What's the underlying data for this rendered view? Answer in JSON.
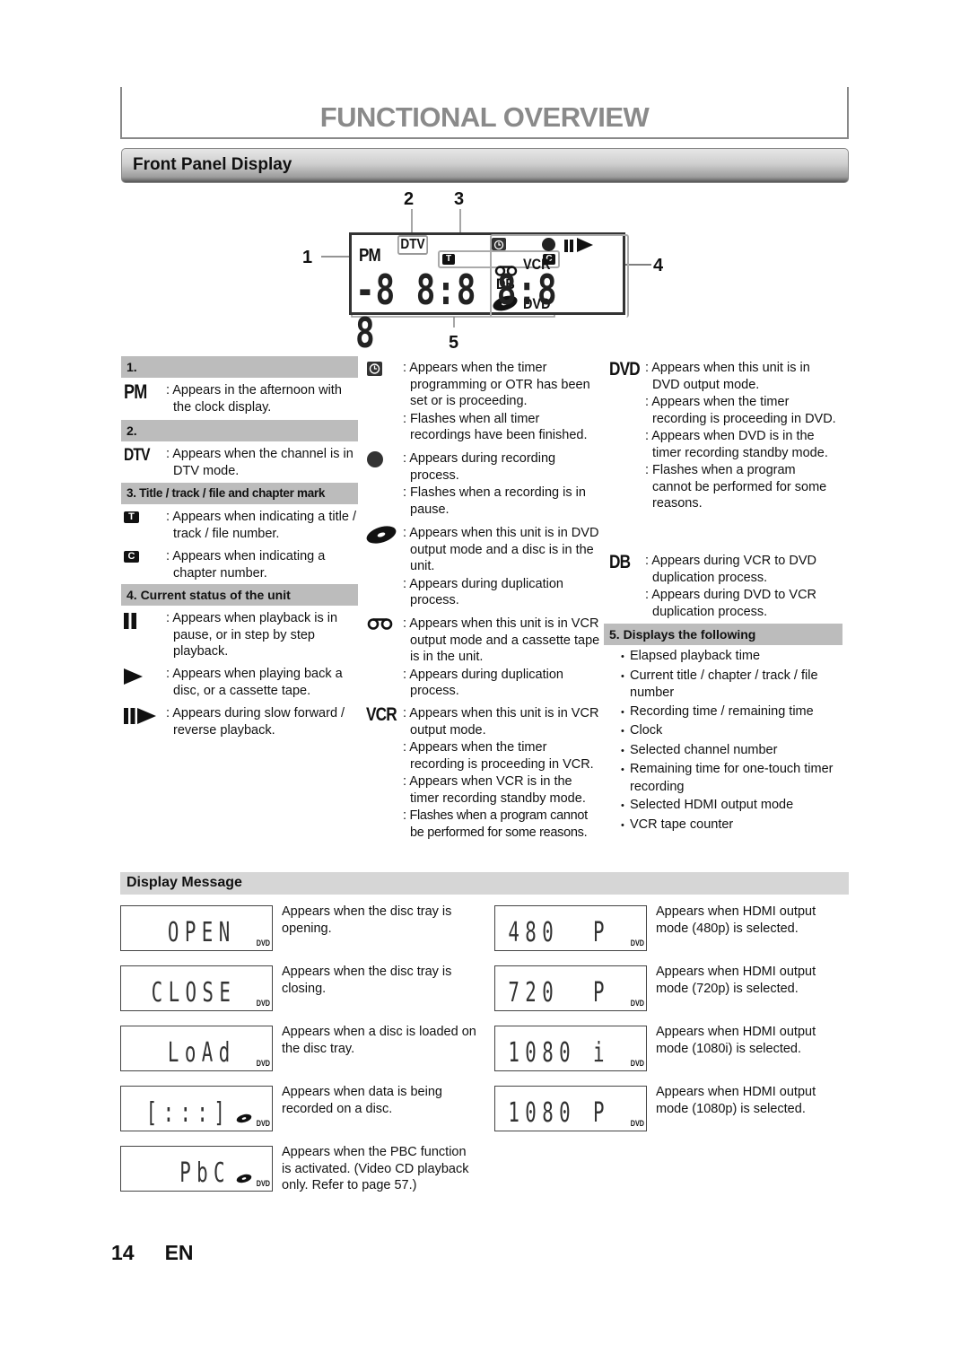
{
  "page": {
    "title": "FUNCTIONAL OVERVIEW",
    "section": "Front Panel Display",
    "page_number": "14",
    "language": "EN"
  },
  "diagram": {
    "callouts": [
      "1",
      "2",
      "3",
      "4",
      "5"
    ],
    "lcd": {
      "pm": "PM",
      "dtv": "DTV",
      "title_mark": "T",
      "chapter_mark": "C",
      "digits": "-8 8:8 8:8 8",
      "vcr": "VCR",
      "db": "DB",
      "dvd": "DVD",
      "icons": [
        "timer-icon",
        "record-icon",
        "pause-icon",
        "play-icon",
        "cassette-icon",
        "disc-icon"
      ]
    }
  },
  "groups": {
    "g1": {
      "heading": "1.",
      "items": [
        {
          "symbol": "PM",
          "lines": [
            ": Appears in the afternoon with the clock display."
          ]
        }
      ]
    },
    "g2": {
      "heading": "2.",
      "items": [
        {
          "symbol": "DTV",
          "lines": [
            ": Appears when the channel is in DTV mode."
          ]
        }
      ]
    },
    "g3": {
      "heading": "3. Title / track / file and chapter mark",
      "items": [
        {
          "symbol": "T",
          "lines": [
            ": Appears when indicating a title / track / file number."
          ]
        },
        {
          "symbol": "C",
          "lines": [
            ": Appears when indicating a chapter number."
          ]
        }
      ]
    },
    "g4": {
      "heading": "4. Current status of the unit",
      "items": [
        {
          "symbol": "pause",
          "lines": [
            ": Appears when playback is in pause, or in step by step playback."
          ]
        },
        {
          "symbol": "play",
          "lines": [
            ": Appears when playing back a disc, or a cassette tape."
          ]
        },
        {
          "symbol": "slow",
          "lines": [
            ": Appears during slow forward / reverse playback."
          ]
        }
      ]
    },
    "mid": [
      {
        "symbol": "timer",
        "lines": [
          ": Appears when the timer programming or OTR has been set or is proceeding.",
          ": Flashes when all timer recordings have been finished."
        ]
      },
      {
        "symbol": "record",
        "lines": [
          ": Appears during recording process.",
          ": Flashes when a recording is in pause."
        ]
      },
      {
        "symbol": "disc",
        "lines": [
          ": Appears when this unit is in DVD output mode and a disc is in the unit.",
          ": Appears during duplication process."
        ]
      },
      {
        "symbol": "cassette",
        "lines": [
          ": Appears when this unit is in VCR output mode and a cassette tape is in the unit.",
          ": Appears during duplication process."
        ]
      },
      {
        "symbol": "VCR",
        "lines": [
          ": Appears when this unit is in VCR output mode.",
          ": Appears when the timer recording is proceeding in VCR.",
          ": Appears when VCR is in the timer recording standby mode.",
          ": Flashes when a program cannot be performed for some reasons."
        ]
      }
    ],
    "right": [
      {
        "symbol": "DVD",
        "lines": [
          ": Appears when this unit is in DVD output mode.",
          ": Appears when the timer recording is proceeding in DVD.",
          ": Appears when DVD is in the timer recording standby mode.",
          ": Flashes when a program cannot be performed for some reasons."
        ]
      },
      {
        "symbol": "DB",
        "lines": [
          ": Appears during VCR to DVD duplication process.",
          ": Appears during DVD to VCR duplication process."
        ]
      }
    ],
    "g5": {
      "heading": "5. Displays the following",
      "bullets": [
        "Elapsed playback time",
        "Current title / chapter / track / file number",
        "Recording time / remaining time",
        "Clock",
        "Selected channel number",
        "Remaining time for one-touch timer recording",
        "Selected HDMI output mode",
        "VCR tape counter"
      ]
    }
  },
  "display_message": {
    "heading": "Display Message",
    "badge": "DVD",
    "left": [
      {
        "display": "OPEN",
        "disc": false,
        "text": "Appears when the disc tray is opening."
      },
      {
        "display": "CLOSE",
        "disc": false,
        "text": "Appears when the disc tray is closing."
      },
      {
        "display": "LoAd",
        "disc": false,
        "text": "Appears when a disc is loaded on the disc tray."
      },
      {
        "display": "[:::]",
        "disc": true,
        "text": "Appears when data is being recorded on a disc."
      },
      {
        "display": "PbC",
        "disc": true,
        "text": "Appears when the PBC function is activated. (Video CD playback only. Refer to page 57.)"
      }
    ],
    "right": [
      {
        "display": "480  P",
        "disc": false,
        "text": "Appears when HDMI output mode (480p) is selected."
      },
      {
        "display": "720  P",
        "disc": false,
        "text": "Appears when HDMI output mode (720p) is selected."
      },
      {
        "display": "1080 i",
        "disc": false,
        "text": "Appears when HDMI output mode (1080i) is selected."
      },
      {
        "display": "1080 P",
        "disc": false,
        "text": "Appears when HDMI output mode (1080p) is selected."
      }
    ]
  }
}
